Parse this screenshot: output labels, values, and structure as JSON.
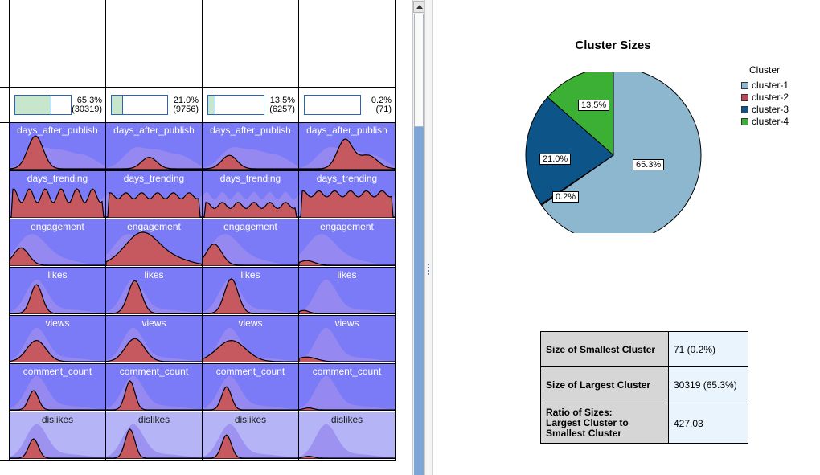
{
  "profile_grid": {
    "clusters": [
      {
        "id": "cluster-1",
        "size_fraction": 0.653,
        "size_pct": "65.3%",
        "size_count": "(30319)"
      },
      {
        "id": "cluster-2",
        "size_fraction": 0.21,
        "size_pct": "21.0%",
        "size_count": "(9756)"
      },
      {
        "id": "cluster-3",
        "size_fraction": 0.135,
        "size_pct": "13.5%",
        "size_count": "(6257)"
      },
      {
        "id": "cluster-4",
        "size_fraction": 0.002,
        "size_pct": "0.2%",
        "size_count": "(71)"
      }
    ],
    "features": [
      "days_after_publish",
      "days_trending",
      "engagement",
      "likes",
      "views",
      "comment_count",
      "dislikes"
    ],
    "colors": {
      "cell_bg": "#7b7bf7",
      "cell_bg_light": "#b4b4f7",
      "overall_density": "#9a8cf0",
      "cluster_density": "#c65860",
      "curve": "#000000"
    }
  },
  "chart_data": {
    "type": "pie",
    "title": "Cluster Sizes",
    "legend_title": "Cluster",
    "legend_position": "right",
    "labels": [
      "cluster-1",
      "cluster-2",
      "cluster-3",
      "cluster-4"
    ],
    "values": [
      65.3,
      0.2,
      21.0,
      13.5
    ],
    "value_labels": [
      "65.3%",
      "0.2%",
      "21.0%",
      "13.5%"
    ],
    "colors": [
      "#8db6cf",
      "#b84857",
      "#0d5488",
      "#3cb034"
    ]
  },
  "legend_items": [
    {
      "label": "cluster-1",
      "color": "#8db6cf"
    },
    {
      "label": "cluster-2",
      "color": "#b84857"
    },
    {
      "label": "cluster-3",
      "color": "#0d5488"
    },
    {
      "label": "cluster-4",
      "color": "#3cb034"
    }
  ],
  "stats_table": [
    {
      "key": "Size of Smallest Cluster",
      "value": "71 (0.2%)"
    },
    {
      "key": "Size of Largest Cluster",
      "value": "30319 (65.3%)"
    },
    {
      "key": "Ratio of Sizes:\nLargest Cluster to\nSmallest Cluster",
      "value": "427.03"
    }
  ]
}
